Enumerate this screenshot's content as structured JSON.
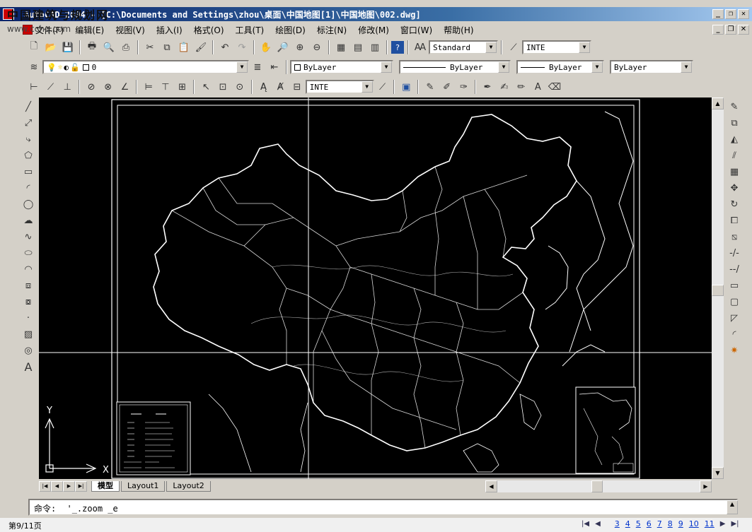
{
  "watermark": {
    "text": "中国建筑与规划网",
    "url": "www.cchq.com"
  },
  "window": {
    "title": "AutoCAD 2004 - [C:\\Documents and Settings\\zhou\\桌面\\中国地图[1]\\中国地图\\002.dwg]",
    "minimize": "_",
    "restore": "❐",
    "close": "✕"
  },
  "menu": {
    "items": [
      "文件(F)",
      "编辑(E)",
      "视图(V)",
      "插入(I)",
      "格式(O)",
      "工具(T)",
      "绘图(D)",
      "标注(N)",
      "修改(M)",
      "窗口(W)",
      "帮助(H)"
    ]
  },
  "toolbar1": {
    "text_style": "Standard",
    "dim_style": "INTE"
  },
  "toolbar2": {
    "layer": "0",
    "color": "ByLayer",
    "linetype": "ByLayer",
    "lineweight": "ByLayer",
    "plotstyle": "ByLayer"
  },
  "toolbar3": {
    "dim_style": "INTE"
  },
  "canvas": {
    "background_color": "#000000",
    "ucs_y_label": "Y",
    "ucs_x_label": "X"
  },
  "tabs": {
    "items": [
      "模型",
      "Layout1",
      "Layout2"
    ],
    "active_index": 0
  },
  "command": {
    "prompt": "命令:",
    "text": "'_.zoom _e"
  },
  "footer": {
    "page_info": "第9/11页",
    "pages": [
      "3",
      "4",
      "5",
      "6",
      "7",
      "8",
      "9",
      "10",
      "11"
    ]
  }
}
